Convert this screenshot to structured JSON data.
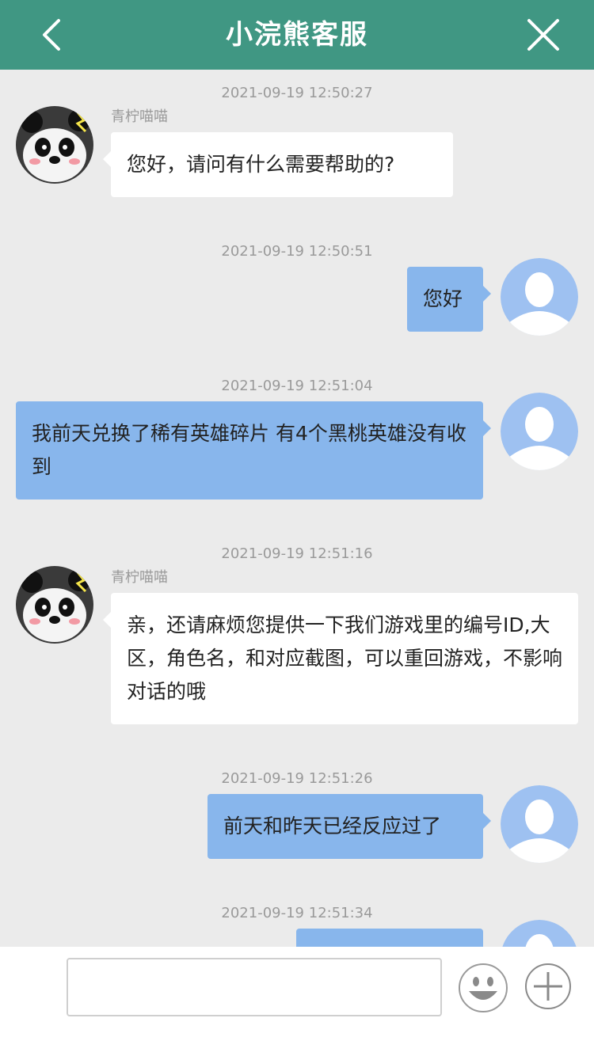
{
  "header": {
    "title": "小浣熊客服",
    "back_icon": "chevron-left-icon",
    "close_icon": "close-icon"
  },
  "colors": {
    "header_bg": "#409783",
    "chat_bg": "#ebebeb",
    "outgoing_bubble": "#88b6ec",
    "incoming_bubble": "#ffffff",
    "user_avatar_bg": "#9ec1f1"
  },
  "messages": [
    {
      "timestamp": "2021-09-19 12:50:27",
      "direction": "in",
      "sender": "青柠喵喵",
      "text": "您好，请问有什么需要帮助的?"
    },
    {
      "timestamp": "2021-09-19 12:50:51",
      "direction": "out",
      "text": "您好"
    },
    {
      "timestamp": "2021-09-19 12:51:04",
      "direction": "out",
      "text": "我前天兑换了稀有英雄碎片 有4个黑桃英雄没有收到"
    },
    {
      "timestamp": "2021-09-19 12:51:16",
      "direction": "in",
      "sender": "青柠喵喵",
      "text": "亲，还请麻烦您提供一下我们游戏里的编号ID,大区，角色名，和对应截图，可以重回游戏，不影响对话的哦"
    },
    {
      "timestamp": "2021-09-19 12:51:26",
      "direction": "out",
      "text": "前天和昨天已经反应过了"
    },
    {
      "timestamp": "2021-09-19 12:51:34",
      "direction": "out",
      "text": ""
    }
  ],
  "footer": {
    "input_value": "",
    "emoji_icon": "smiley-icon",
    "plus_icon": "plus-circle-icon"
  }
}
